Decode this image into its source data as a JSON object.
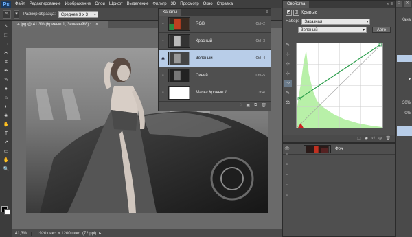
{
  "app": {
    "logo": "Ps"
  },
  "menubar": [
    "Файл",
    "Редактирование",
    "Изображение",
    "Слои",
    "Текст",
    "Выделение",
    "Фильтр",
    "3D",
    "Просмотр",
    "Окно",
    "Справка"
  ],
  "menubar_visible": [
    "Файл",
    "Редактирование",
    "Изображение",
    "Слои",
    "Шрифт",
    "Выделение",
    "Фильтр",
    "3D",
    "Просмотр",
    "Окно",
    "Справка"
  ],
  "window_controls": [
    "–",
    "□",
    "✕"
  ],
  "options": {
    "label": "Размер образца:",
    "sample_value": "Среднее 3 х 3"
  },
  "document": {
    "tab_title": "14.jpg @ 41,3% (Кривые 1, Зеленый/8) *",
    "close": "×",
    "zoom": "41,3%",
    "info": "1920 пикс. x 1200 пикс. (72 ppi)",
    "arrow": "▸"
  },
  "channels_panel": {
    "tab": "Каналы",
    "menu": "≡",
    "channels": [
      {
        "name": "RGB",
        "shortcut": "Ctrl+2",
        "selected": false,
        "visible": false
      },
      {
        "name": "Красный",
        "shortcut": "Ctrl+3",
        "selected": false,
        "visible": false
      },
      {
        "name": "Зеленый",
        "shortcut": "Ctrl+4",
        "selected": true,
        "visible": true
      },
      {
        "name": "Синий",
        "shortcut": "Ctrl+5",
        "selected": false,
        "visible": false
      },
      {
        "name": "Маска Кривые 1",
        "shortcut": "Ctrl+\\",
        "selected": false,
        "visible": false
      }
    ],
    "footer_icons": [
      "◌",
      "▣",
      "⧉",
      "🗑"
    ]
  },
  "properties_panel": {
    "tab": "Свойства",
    "controls": "» ≡",
    "title": "Кривые",
    "preset_label": "Набор:",
    "preset_value": "Заказная",
    "channel_value": "Зеленый",
    "auto_button": "Авто",
    "footer_icons": [
      "⬚",
      "◉",
      "↺",
      "◎",
      "🗑"
    ]
  },
  "curve_tools": [
    "✎",
    "⊹",
    "⊹",
    "⊹",
    "〜",
    "✎",
    "⚖"
  ],
  "right_strip": [
    "Кана",
    "▾",
    "30%",
    "0%",
    "0%"
  ],
  "layers": {
    "row_name": "Фон",
    "eye": "👁"
  },
  "tools": [
    "↖",
    "⬚",
    "◌",
    "✂",
    "⌗",
    "✒",
    "✎",
    "♦",
    "⌂",
    "◐",
    "◈",
    "✋",
    "T",
    "↗",
    "▭",
    "✋",
    "🔍"
  ],
  "colors": {
    "selection_blue": "#b8cde8",
    "curve_line": "#2a9d4a",
    "histogram": "#b8f0a8"
  }
}
